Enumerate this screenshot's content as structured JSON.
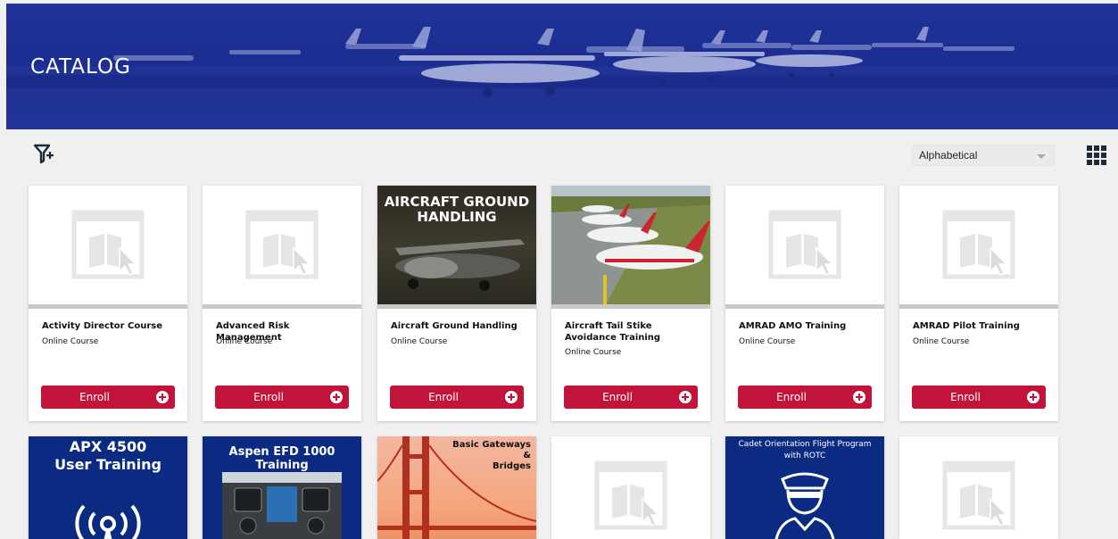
{
  "banner": {
    "title": "CATALOG"
  },
  "toolbar": {
    "sort_selected": "Alphabetical"
  },
  "colors": {
    "banner_blue": "#1f3190",
    "enroll_red": "#c2143a",
    "card_bg": "#ffffff",
    "page_bg": "#f0f0f0"
  },
  "courses": [
    {
      "title": "Activity Director Course",
      "type": "Online Course",
      "enroll_label": "Enroll",
      "thumb": "placeholder-course-icon"
    },
    {
      "title": "Advanced Risk Management",
      "type": "Online Course",
      "enroll_label": "Enroll",
      "thumb": "placeholder-course-icon"
    },
    {
      "title": "Aircraft Ground Handling",
      "type": "Online Course",
      "enroll_label": "Enroll",
      "thumb": "aircraft-photo",
      "thumb_text": [
        "AIRCRAFT GROUND",
        "HANDLING"
      ]
    },
    {
      "title": "Aircraft Tail Stike Avoidance Training",
      "type": "Online Course",
      "enroll_label": "Enroll",
      "thumb": "runway-planes-photo"
    },
    {
      "title": "AMRAD AMO Training",
      "type": "Online Course",
      "enroll_label": "Enroll",
      "thumb": "placeholder-course-icon"
    },
    {
      "title": "AMRAD Pilot Training",
      "type": "Online Course",
      "enroll_label": "Enroll",
      "thumb": "placeholder-course-icon"
    }
  ],
  "row2": [
    {
      "thumb": "radio-signal-icon",
      "thumb_text": [
        "APX 4500",
        "User Training"
      ]
    },
    {
      "thumb": "cockpit-photo",
      "thumb_text": [
        "Aspen EFD 1000 Training"
      ]
    },
    {
      "thumb": "golden-gate-photo",
      "thumb_text": [
        "Basic Gateways",
        "&",
        "Bridges"
      ]
    },
    {
      "thumb": "placeholder-course-icon"
    },
    {
      "thumb": "pilot-icon",
      "thumb_text": [
        "Cadet Orientation Flight Program",
        "with ROTC"
      ]
    },
    {
      "thumb": "placeholder-course-icon"
    }
  ]
}
